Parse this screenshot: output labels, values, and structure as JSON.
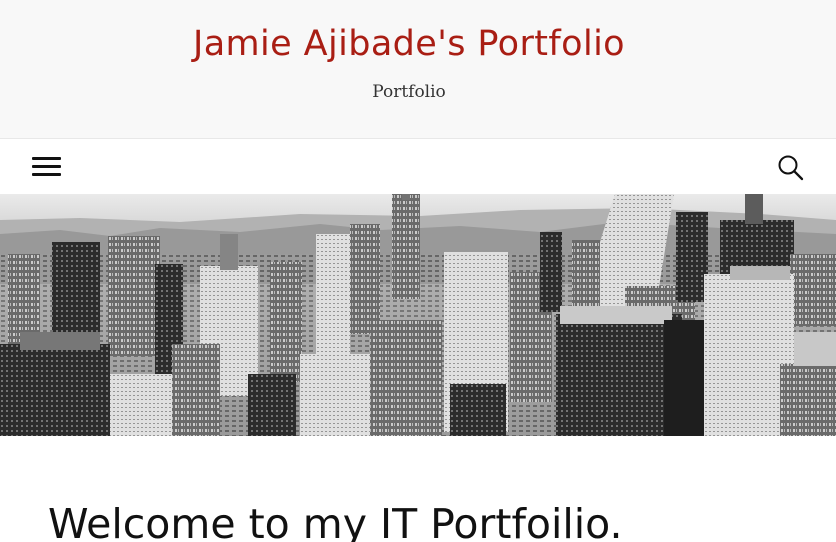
{
  "header": {
    "site_title": "Jamie Ajibade's Portfolio",
    "site_description": "Portfolio",
    "title_color": "#a91e14"
  },
  "nav": {
    "menu_icon": "hamburger-menu-icon",
    "search_icon": "search-icon"
  },
  "hero": {
    "image": "black-and-white city skyline"
  },
  "content": {
    "heading": "Welcome to my IT Portfoilio."
  }
}
